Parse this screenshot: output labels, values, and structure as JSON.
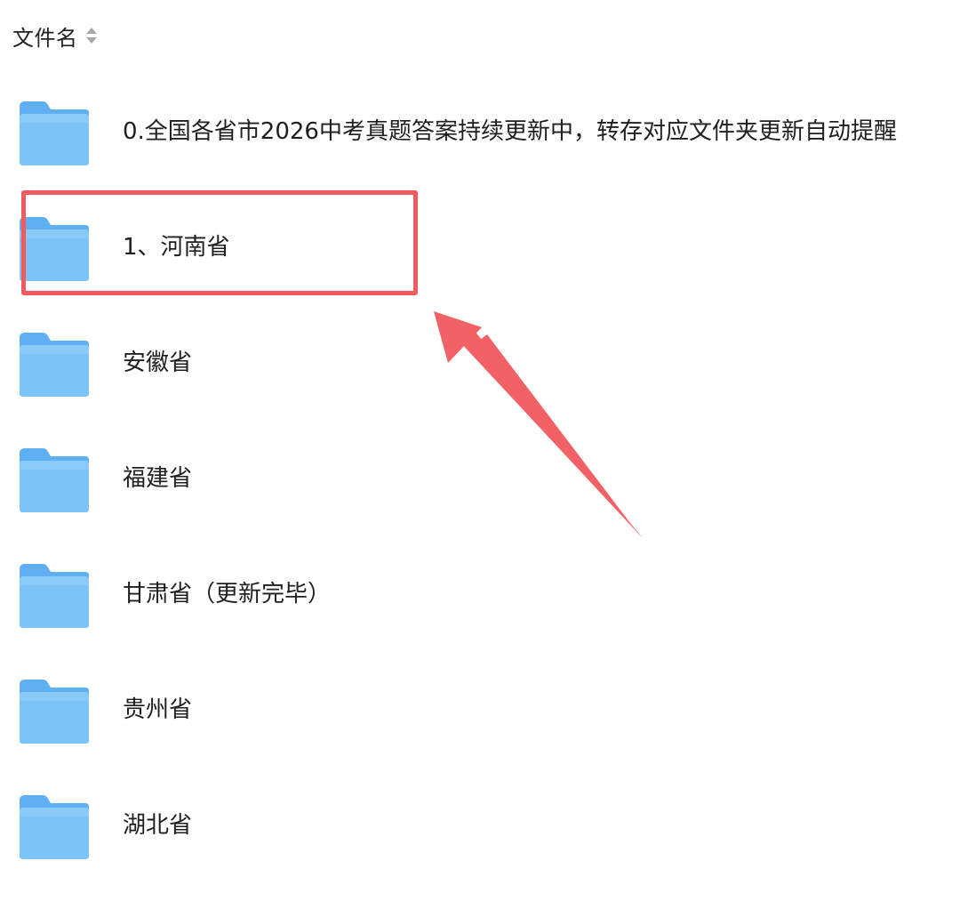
{
  "header": {
    "label": "文件名",
    "sort_icon": "sort-updown-icon"
  },
  "folders": [
    {
      "label": "0.全国各省市2026中考真题答案持续更新中，转存对应文件夹更新自动提醒",
      "icon": "folder-icon"
    },
    {
      "label": "1、河南省",
      "icon": "folder-icon",
      "highlighted": true
    },
    {
      "label": "安徽省",
      "icon": "folder-icon"
    },
    {
      "label": "福建省",
      "icon": "folder-icon"
    },
    {
      "label": "甘肃省（更新完毕）",
      "icon": "folder-icon"
    },
    {
      "label": "贵州省",
      "icon": "folder-icon"
    },
    {
      "label": "湖北省",
      "icon": "folder-icon"
    }
  ],
  "annotation": {
    "box_color": "#f15a5f",
    "arrow_color": "#f26166"
  },
  "colors": {
    "folder_body": "#7cc4f8",
    "folder_tab": "#5fb0f2"
  }
}
